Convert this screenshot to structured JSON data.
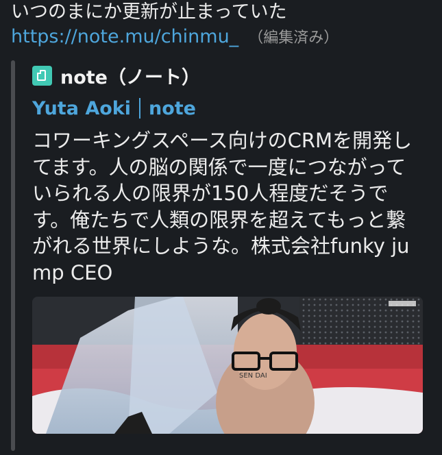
{
  "message": {
    "text": "いつのまにか更新が止まっていた",
    "link": "https://note.mu/chinmu_",
    "edited_label": "（編集済み）"
  },
  "attachment": {
    "service_icon": "note-icon",
    "service_name": "note（ノート）",
    "author": "Yuta Aoki",
    "site": "note",
    "description": "コワーキングスペース向けのCRMを開発してます。人の脳の関係で一度につながっていられる人の限界が150人程度だそうです。俺たちで人類の限界を超えてもっと繋がれる世界にしような。株式会社funky jump CEO",
    "image_overlay_text": "SEN DAI"
  },
  "colors": {
    "background": "#1a1d21",
    "link": "#4ea6dc",
    "note_brand": "#41c9b4"
  }
}
